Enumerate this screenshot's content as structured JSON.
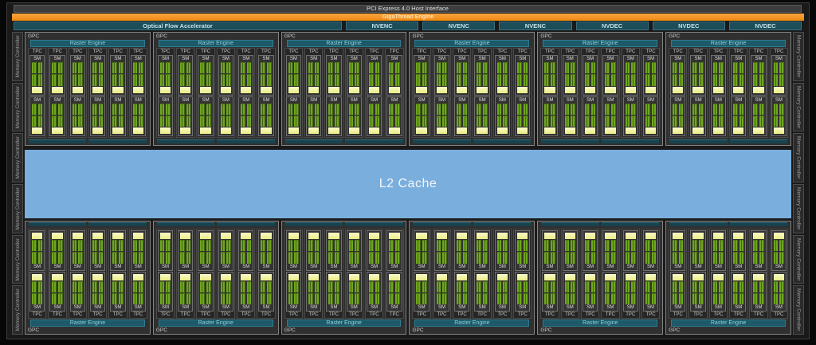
{
  "top": {
    "pci_label": "PCI Express 4.0 Host Interface",
    "gigathread_label": "GigaThread Engine",
    "optical_flow_label": "Optical Flow Accelerator",
    "codec_blocks": [
      "NVENC",
      "NVENC",
      "NVENC",
      "NVDEC",
      "NVDEC",
      "NVDEC"
    ]
  },
  "memory": {
    "label": "Memory Controller",
    "segments_per_side": 6
  },
  "l2": {
    "label": "L2 Cache"
  },
  "gpc": {
    "label": "GPC",
    "raster_label": "Raster Engine",
    "tpc_label": "TPC",
    "sm_label": "SM",
    "gpcs_per_row": 6,
    "rows": 2,
    "tpcs_per_gpc": 6,
    "sms_per_tpc": 2,
    "green_rows_per_sm": 2,
    "green_cells_per_row": 2,
    "bottom_bars_per_gpc": 2
  },
  "colors": {
    "orange": "#f7941e",
    "teal": "#1d4d59",
    "raster_teal": "#1d5968",
    "green": "#70a71e",
    "green_stripe": "#42670f",
    "yellow": "#eef194",
    "l2_blue": "#7aaedd"
  }
}
